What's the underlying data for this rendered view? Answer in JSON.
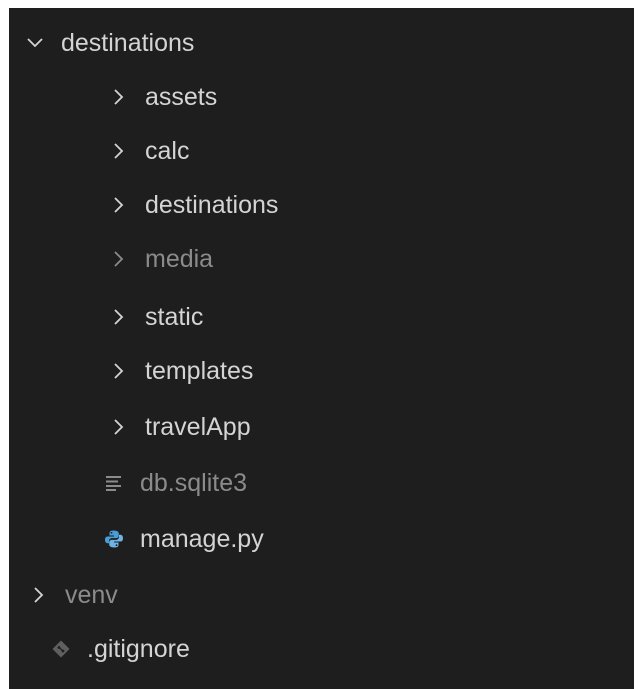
{
  "explorer": {
    "items": [
      {
        "label": "destinations",
        "icon": "chevron-down-icon"
      },
      {
        "label": "assets",
        "icon": "chevron-right-icon"
      },
      {
        "label": "calc",
        "icon": "chevron-right-icon"
      },
      {
        "label": "destinations",
        "icon": "chevron-right-icon"
      },
      {
        "label": "media",
        "icon": "chevron-right-icon"
      },
      {
        "label": "static",
        "icon": "chevron-right-icon"
      },
      {
        "label": "templates",
        "icon": "chevron-right-icon"
      },
      {
        "label": "travelApp",
        "icon": "chevron-right-icon"
      },
      {
        "label": "db.sqlite3",
        "icon": "text-file-icon"
      },
      {
        "label": "manage.py",
        "icon": "python-file-icon"
      },
      {
        "label": "venv",
        "icon": "chevron-right-icon"
      },
      {
        "label": ".gitignore",
        "icon": "git-file-icon"
      }
    ]
  },
  "colors": {
    "background": "#1e1e1e",
    "text": "#d4d4d4",
    "muted_text": "#8b8b8b",
    "python_icon": "#4a9cd6"
  }
}
